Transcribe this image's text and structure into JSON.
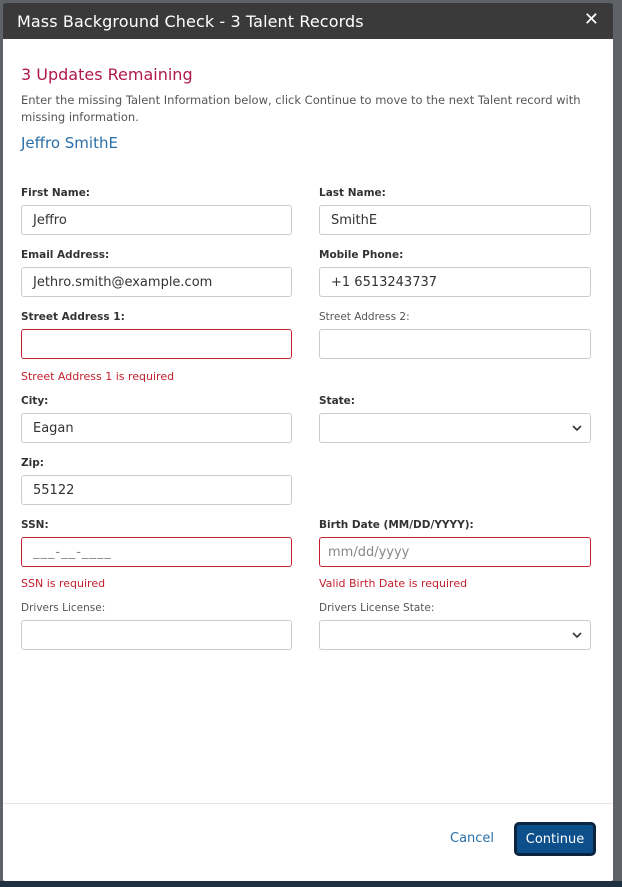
{
  "modal": {
    "title": "Mass Background Check - 3 Talent Records",
    "close_glyph": "✕"
  },
  "status": {
    "updates_remaining": "3 Updates Remaining",
    "instructions": "Enter the missing Talent Information below, click Continue to move to the next Talent record with missing information.",
    "talent_name": "Jeffro SmithE"
  },
  "form": {
    "first_name": {
      "label": "First Name:",
      "value": "Jeffro"
    },
    "last_name": {
      "label": "Last Name:",
      "value": "SmithE"
    },
    "email": {
      "label": "Email Address:",
      "value": "Jethro.smith@example.com"
    },
    "mobile_phone": {
      "label": "Mobile Phone:",
      "value": "+1 6513243737"
    },
    "street1": {
      "label": "Street Address 1:",
      "value": "",
      "error": "Street Address 1 is required"
    },
    "street2": {
      "label": "Street Address 2:",
      "value": ""
    },
    "city": {
      "label": "City:",
      "value": "Eagan"
    },
    "state": {
      "label": "State:",
      "value": ""
    },
    "zip": {
      "label": "Zip:",
      "value": "55122"
    },
    "ssn": {
      "label": "SSN:",
      "placeholder": "___-__-____",
      "error": "SSN is required"
    },
    "birth_date": {
      "label": "Birth Date (MM/DD/YYYY):",
      "placeholder": "mm/dd/yyyy",
      "error": "Valid Birth Date is required"
    },
    "drivers_license": {
      "label": "Drivers License:",
      "value": ""
    },
    "drivers_license_state": {
      "label": "Drivers License State:",
      "value": ""
    }
  },
  "footer": {
    "cancel_label": "Cancel",
    "continue_label": "Continue"
  },
  "icons": {
    "close": "close-icon",
    "select": "chevron-down-icon"
  },
  "colors": {
    "header_bg": "#3a3a3a",
    "accent_red": "#b0184c",
    "error_red": "#c2202e",
    "link_blue": "#2a6fa8",
    "primary_button": "#0d4f8b"
  }
}
